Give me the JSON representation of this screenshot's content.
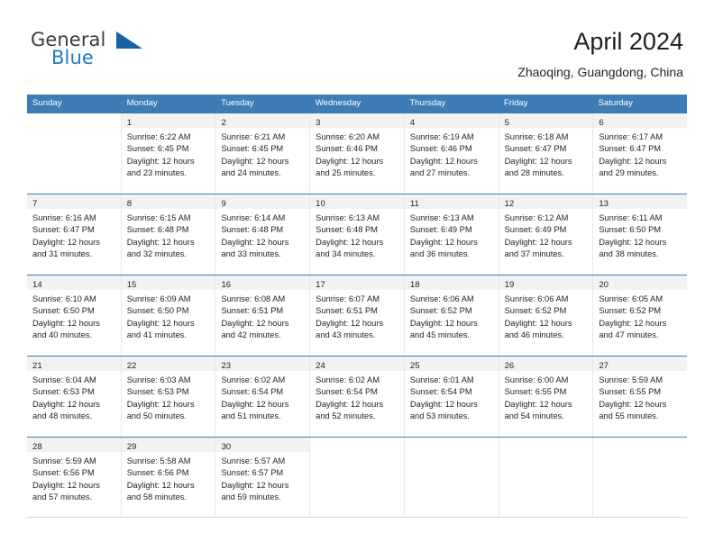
{
  "brand": {
    "name_part1": "General",
    "name_part2": "Blue",
    "accent_color": "#1463a5"
  },
  "header": {
    "title": "April 2024",
    "subtitle": "Zhaoqing, Guangdong, China"
  },
  "theme": {
    "header_blue": "#3d7cb5",
    "daynum_band": "#f2f2f2",
    "text": "#231f20"
  },
  "weekdays": [
    "Sunday",
    "Monday",
    "Tuesday",
    "Wednesday",
    "Thursday",
    "Friday",
    "Saturday"
  ],
  "weeks": [
    [
      {
        "day": "",
        "sunrise": "",
        "sunset": "",
        "daylight": ""
      },
      {
        "day": "1",
        "sunrise": "Sunrise: 6:22 AM",
        "sunset": "Sunset: 6:45 PM",
        "daylight": "Daylight: 12 hours and 23 minutes."
      },
      {
        "day": "2",
        "sunrise": "Sunrise: 6:21 AM",
        "sunset": "Sunset: 6:45 PM",
        "daylight": "Daylight: 12 hours and 24 minutes."
      },
      {
        "day": "3",
        "sunrise": "Sunrise: 6:20 AM",
        "sunset": "Sunset: 6:46 PM",
        "daylight": "Daylight: 12 hours and 25 minutes."
      },
      {
        "day": "4",
        "sunrise": "Sunrise: 6:19 AM",
        "sunset": "Sunset: 6:46 PM",
        "daylight": "Daylight: 12 hours and 27 minutes."
      },
      {
        "day": "5",
        "sunrise": "Sunrise: 6:18 AM",
        "sunset": "Sunset: 6:47 PM",
        "daylight": "Daylight: 12 hours and 28 minutes."
      },
      {
        "day": "6",
        "sunrise": "Sunrise: 6:17 AM",
        "sunset": "Sunset: 6:47 PM",
        "daylight": "Daylight: 12 hours and 29 minutes."
      }
    ],
    [
      {
        "day": "7",
        "sunrise": "Sunrise: 6:16 AM",
        "sunset": "Sunset: 6:47 PM",
        "daylight": "Daylight: 12 hours and 31 minutes."
      },
      {
        "day": "8",
        "sunrise": "Sunrise: 6:15 AM",
        "sunset": "Sunset: 6:48 PM",
        "daylight": "Daylight: 12 hours and 32 minutes."
      },
      {
        "day": "9",
        "sunrise": "Sunrise: 6:14 AM",
        "sunset": "Sunset: 6:48 PM",
        "daylight": "Daylight: 12 hours and 33 minutes."
      },
      {
        "day": "10",
        "sunrise": "Sunrise: 6:13 AM",
        "sunset": "Sunset: 6:48 PM",
        "daylight": "Daylight: 12 hours and 34 minutes."
      },
      {
        "day": "11",
        "sunrise": "Sunrise: 6:13 AM",
        "sunset": "Sunset: 6:49 PM",
        "daylight": "Daylight: 12 hours and 36 minutes."
      },
      {
        "day": "12",
        "sunrise": "Sunrise: 6:12 AM",
        "sunset": "Sunset: 6:49 PM",
        "daylight": "Daylight: 12 hours and 37 minutes."
      },
      {
        "day": "13",
        "sunrise": "Sunrise: 6:11 AM",
        "sunset": "Sunset: 6:50 PM",
        "daylight": "Daylight: 12 hours and 38 minutes."
      }
    ],
    [
      {
        "day": "14",
        "sunrise": "Sunrise: 6:10 AM",
        "sunset": "Sunset: 6:50 PM",
        "daylight": "Daylight: 12 hours and 40 minutes."
      },
      {
        "day": "15",
        "sunrise": "Sunrise: 6:09 AM",
        "sunset": "Sunset: 6:50 PM",
        "daylight": "Daylight: 12 hours and 41 minutes."
      },
      {
        "day": "16",
        "sunrise": "Sunrise: 6:08 AM",
        "sunset": "Sunset: 6:51 PM",
        "daylight": "Daylight: 12 hours and 42 minutes."
      },
      {
        "day": "17",
        "sunrise": "Sunrise: 6:07 AM",
        "sunset": "Sunset: 6:51 PM",
        "daylight": "Daylight: 12 hours and 43 minutes."
      },
      {
        "day": "18",
        "sunrise": "Sunrise: 6:06 AM",
        "sunset": "Sunset: 6:52 PM",
        "daylight": "Daylight: 12 hours and 45 minutes."
      },
      {
        "day": "19",
        "sunrise": "Sunrise: 6:06 AM",
        "sunset": "Sunset: 6:52 PM",
        "daylight": "Daylight: 12 hours and 46 minutes."
      },
      {
        "day": "20",
        "sunrise": "Sunrise: 6:05 AM",
        "sunset": "Sunset: 6:52 PM",
        "daylight": "Daylight: 12 hours and 47 minutes."
      }
    ],
    [
      {
        "day": "21",
        "sunrise": "Sunrise: 6:04 AM",
        "sunset": "Sunset: 6:53 PM",
        "daylight": "Daylight: 12 hours and 48 minutes."
      },
      {
        "day": "22",
        "sunrise": "Sunrise: 6:03 AM",
        "sunset": "Sunset: 6:53 PM",
        "daylight": "Daylight: 12 hours and 50 minutes."
      },
      {
        "day": "23",
        "sunrise": "Sunrise: 6:02 AM",
        "sunset": "Sunset: 6:54 PM",
        "daylight": "Daylight: 12 hours and 51 minutes."
      },
      {
        "day": "24",
        "sunrise": "Sunrise: 6:02 AM",
        "sunset": "Sunset: 6:54 PM",
        "daylight": "Daylight: 12 hours and 52 minutes."
      },
      {
        "day": "25",
        "sunrise": "Sunrise: 6:01 AM",
        "sunset": "Sunset: 6:54 PM",
        "daylight": "Daylight: 12 hours and 53 minutes."
      },
      {
        "day": "26",
        "sunrise": "Sunrise: 6:00 AM",
        "sunset": "Sunset: 6:55 PM",
        "daylight": "Daylight: 12 hours and 54 minutes."
      },
      {
        "day": "27",
        "sunrise": "Sunrise: 5:59 AM",
        "sunset": "Sunset: 6:55 PM",
        "daylight": "Daylight: 12 hours and 55 minutes."
      }
    ],
    [
      {
        "day": "28",
        "sunrise": "Sunrise: 5:59 AM",
        "sunset": "Sunset: 6:56 PM",
        "daylight": "Daylight: 12 hours and 57 minutes."
      },
      {
        "day": "29",
        "sunrise": "Sunrise: 5:58 AM",
        "sunset": "Sunset: 6:56 PM",
        "daylight": "Daylight: 12 hours and 58 minutes."
      },
      {
        "day": "30",
        "sunrise": "Sunrise: 5:57 AM",
        "sunset": "Sunset: 6:57 PM",
        "daylight": "Daylight: 12 hours and 59 minutes."
      },
      {
        "day": "",
        "sunrise": "",
        "sunset": "",
        "daylight": ""
      },
      {
        "day": "",
        "sunrise": "",
        "sunset": "",
        "daylight": ""
      },
      {
        "day": "",
        "sunrise": "",
        "sunset": "",
        "daylight": ""
      },
      {
        "day": "",
        "sunrise": "",
        "sunset": "",
        "daylight": ""
      }
    ]
  ]
}
